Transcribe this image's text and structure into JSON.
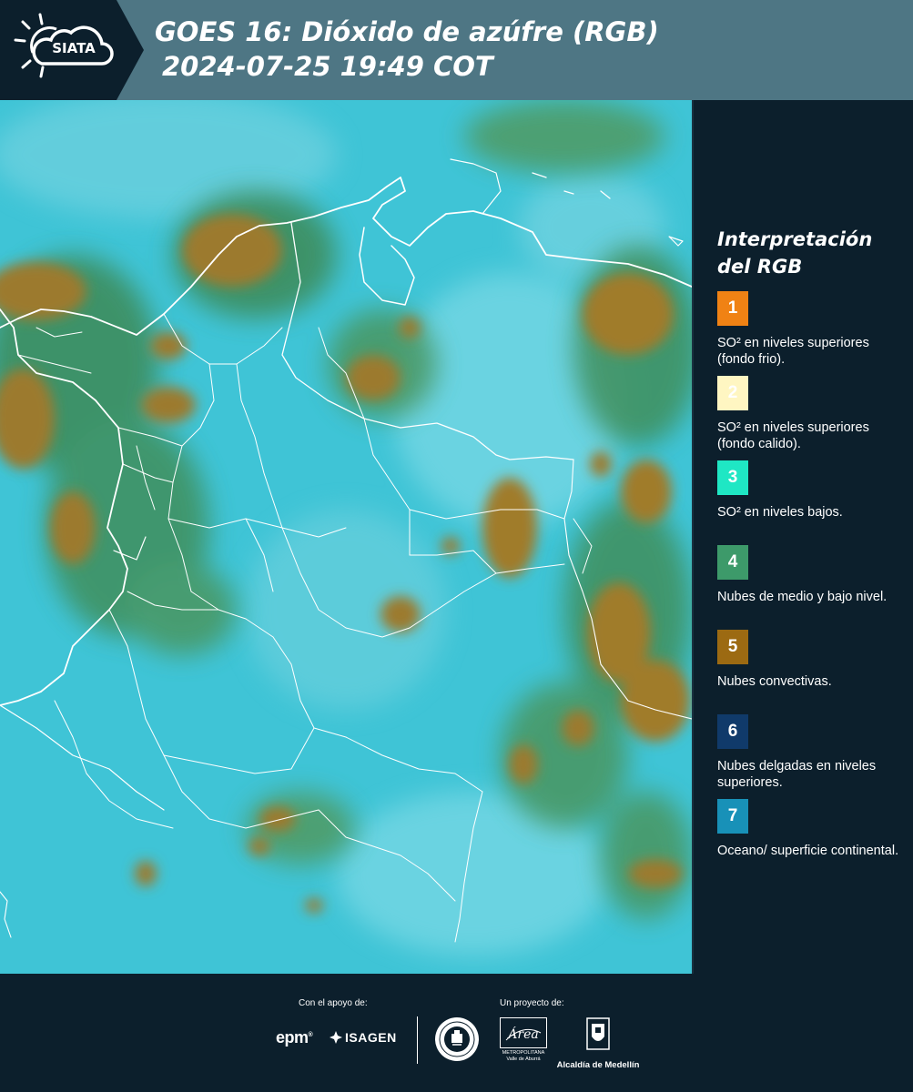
{
  "header": {
    "logo_text": "SIATA",
    "title_line1": "GOES 16: Dióxido de azúfre (RGB)",
    "title_line2": "2024-07-25 19:49 COT",
    "bar_color": "#4e7684",
    "logo_bg_color": "#0c1f2c"
  },
  "legend": {
    "title": "Interpretación del RGB",
    "items": [
      {
        "number": "1",
        "color": "#f08214",
        "description": "SO² en niveles superiores (fondo frio)."
      },
      {
        "number": "2",
        "color": "#fff6c2",
        "description": "SO² en niveles superiores (fondo calido)."
      },
      {
        "number": "3",
        "color": "#1fe7c4",
        "description": "SO² en niveles bajos."
      },
      {
        "number": "4",
        "color": "#3d9a6a",
        "description": "Nubes de medio y bajo nivel."
      },
      {
        "number": "5",
        "color": "#9c6a12",
        "description": "Nubes convectivas."
      },
      {
        "number": "6",
        "color": "#103a6a",
        "description": "Nubes delgadas en niveles superiores."
      },
      {
        "number": "7",
        "color": "#1891b8",
        "description": "Oceano/ superficie continental."
      }
    ]
  },
  "map": {
    "background_color": "#3fc4d6",
    "cloud_convective_color": "#9c7a2e",
    "cloud_midlow_color": "#3d8a56",
    "border_color": "#ffffff"
  },
  "footer": {
    "support_label": "Con el apoyo de:",
    "project_label": "Un proyecto de:",
    "epm_text": "epm",
    "isagen_text": "ISAGEN",
    "area_script": "Área",
    "area_small_text": "METROPOLITANA Valle de Aburrá",
    "alcaldia_text": "Alcaldía de Medellín"
  }
}
